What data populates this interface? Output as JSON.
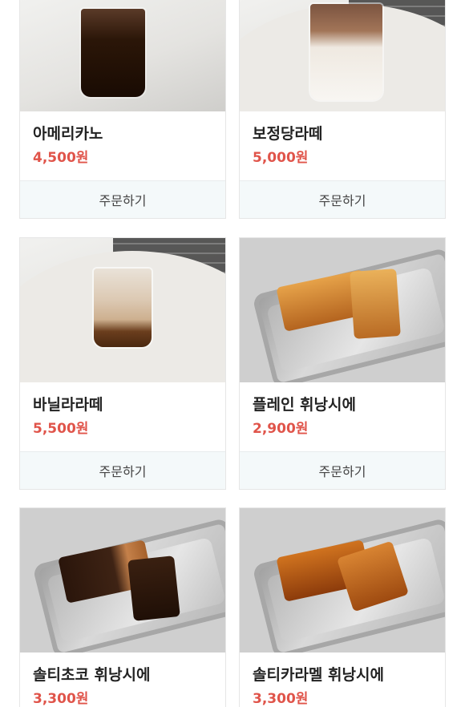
{
  "order_label": "주문하기",
  "products": [
    {
      "name": "아메리카노",
      "price": "4,500원",
      "image": "iced-americano-photo"
    },
    {
      "name": "보정당라떼",
      "price": "5,000원",
      "image": "iced-latte-photo"
    },
    {
      "name": "바닐라라떼",
      "price": "5,500원",
      "image": "iced-vanilla-latte-photo"
    },
    {
      "name": "플레인 휘낭시에",
      "price": "2,900원",
      "image": "plain-financier-photo"
    },
    {
      "name": "솔티초코 휘낭시에",
      "price": "3,300원",
      "image": "salty-chocolate-financier-photo"
    },
    {
      "name": "솔티카라멜 휘낭시에",
      "price": "3,300원",
      "image": "salty-caramel-financier-photo"
    }
  ],
  "colors": {
    "price": "#e0544a",
    "order_button_bg": "#f4f9fa"
  }
}
